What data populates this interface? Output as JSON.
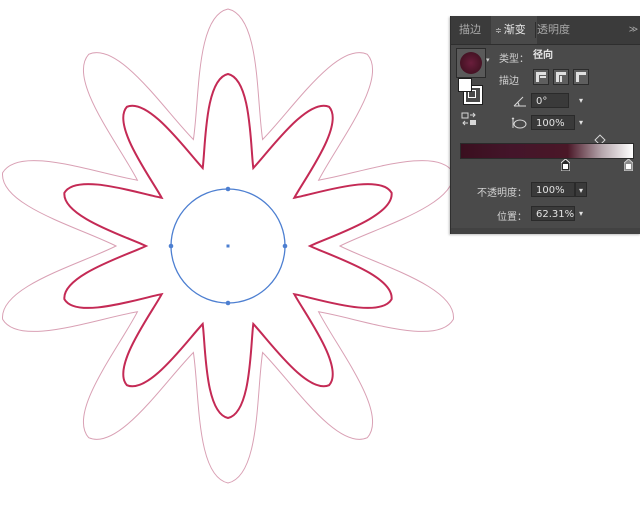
{
  "panel": {
    "tabs": [
      {
        "label": "描边",
        "active": false
      },
      {
        "label": "渐变",
        "active": true
      },
      {
        "label": "透明度",
        "active": false
      }
    ],
    "menu_icon": "panel-menu-icon",
    "type_label": "类型：",
    "type_value": "径向",
    "stroke_label": "描边",
    "angle_value": "0°",
    "aspect_value": "100%",
    "opacity_label": "不透明度：",
    "opacity_value": "100%",
    "location_label": "位置：",
    "location_value": "62.31%",
    "gradient_colors": [
      "#3a0f1f",
      "#4a1727",
      "#ffffff"
    ]
  },
  "canvas": {
    "outer_flower_color": "#d9a0b4",
    "inner_flower_color": "#c42a55",
    "circle_color": "#4d7fd1"
  }
}
